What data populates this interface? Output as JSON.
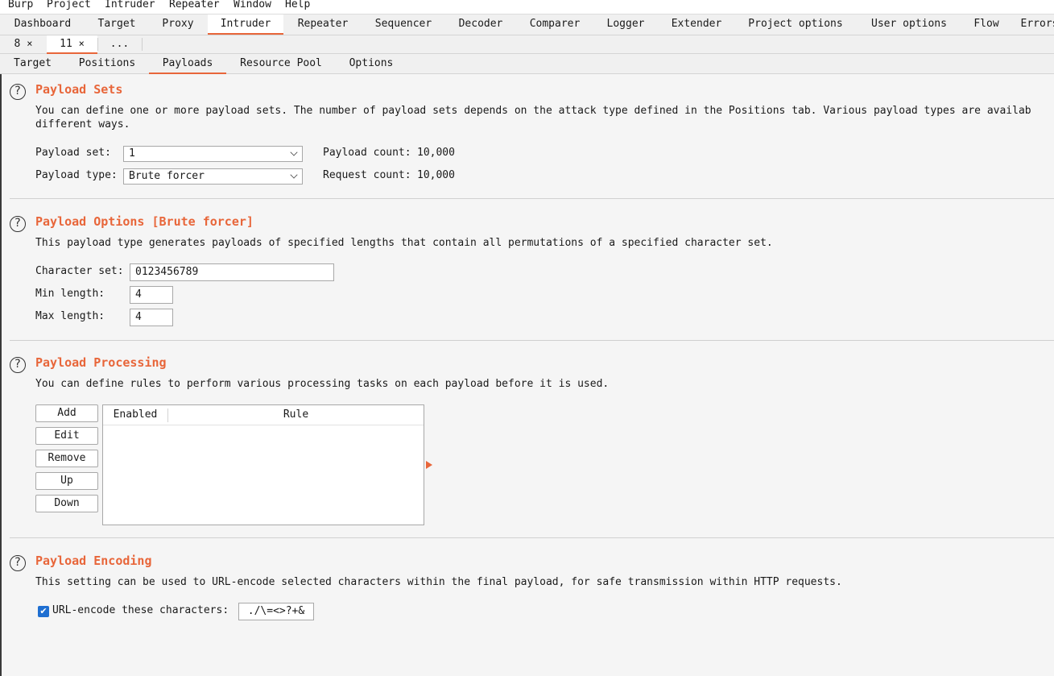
{
  "menubar": [
    "Burp",
    "Project",
    "Intruder",
    "Repeater",
    "Window",
    "Help"
  ],
  "main_tabs": [
    "Dashboard",
    "Target",
    "Proxy",
    "Intruder",
    "Repeater",
    "Sequencer",
    "Decoder",
    "Comparer",
    "Logger",
    "Extender",
    "Project options",
    "User options",
    "Flow",
    "Errors"
  ],
  "main_tabs_active": "Intruder",
  "attack_tabs": [
    {
      "label": "8",
      "close": "×"
    },
    {
      "label": "11",
      "close": "×"
    },
    {
      "label": "...",
      "close": ""
    }
  ],
  "inner_tabs": [
    "Target",
    "Positions",
    "Payloads",
    "Resource Pool",
    "Options"
  ],
  "inner_tabs_active": "Payloads",
  "payload_sets": {
    "help": "?",
    "title": "Payload Sets",
    "desc_line1": "You can define one or more payload sets. The number of payload sets depends on the attack type defined in the Positions tab. Various payload types are availab",
    "desc_line2": "different ways.",
    "set_label": "Payload set:",
    "set_value": "1",
    "type_label": "Payload type:",
    "type_value": "Brute forcer",
    "payload_count_label": "Payload count:",
    "payload_count": "10,000",
    "request_count_label": "Request count:",
    "request_count": "10,000"
  },
  "payload_options": {
    "help": "?",
    "title": "Payload Options [Brute forcer]",
    "desc": "This payload type generates payloads of specified lengths that contain all permutations of a specified character set.",
    "charset_label": "Character set:",
    "charset_value": "0123456789",
    "min_label": "Min length:",
    "min_value": "4",
    "max_label": "Max length:",
    "max_value": "4"
  },
  "payload_processing": {
    "help": "?",
    "title": "Payload Processing",
    "desc": "You can define rules to perform various processing tasks on each payload before it is used.",
    "buttons": {
      "add": "Add",
      "edit": "Edit",
      "remove": "Remove",
      "up": "Up",
      "down": "Down"
    },
    "columns": [
      "Enabled",
      "Rule"
    ]
  },
  "payload_encoding": {
    "help": "?",
    "title": "Payload Encoding",
    "desc": "This setting can be used to URL-encode selected characters within the final payload, for safe transmission within HTTP requests.",
    "checkbox_checked": true,
    "checkbox_label": "URL-encode these characters:",
    "characters": "./\\=<>?+&",
    "checkmark": "✔"
  },
  "colors": {
    "accent": "#e8663a",
    "checkbox": "#1f6fd1"
  }
}
